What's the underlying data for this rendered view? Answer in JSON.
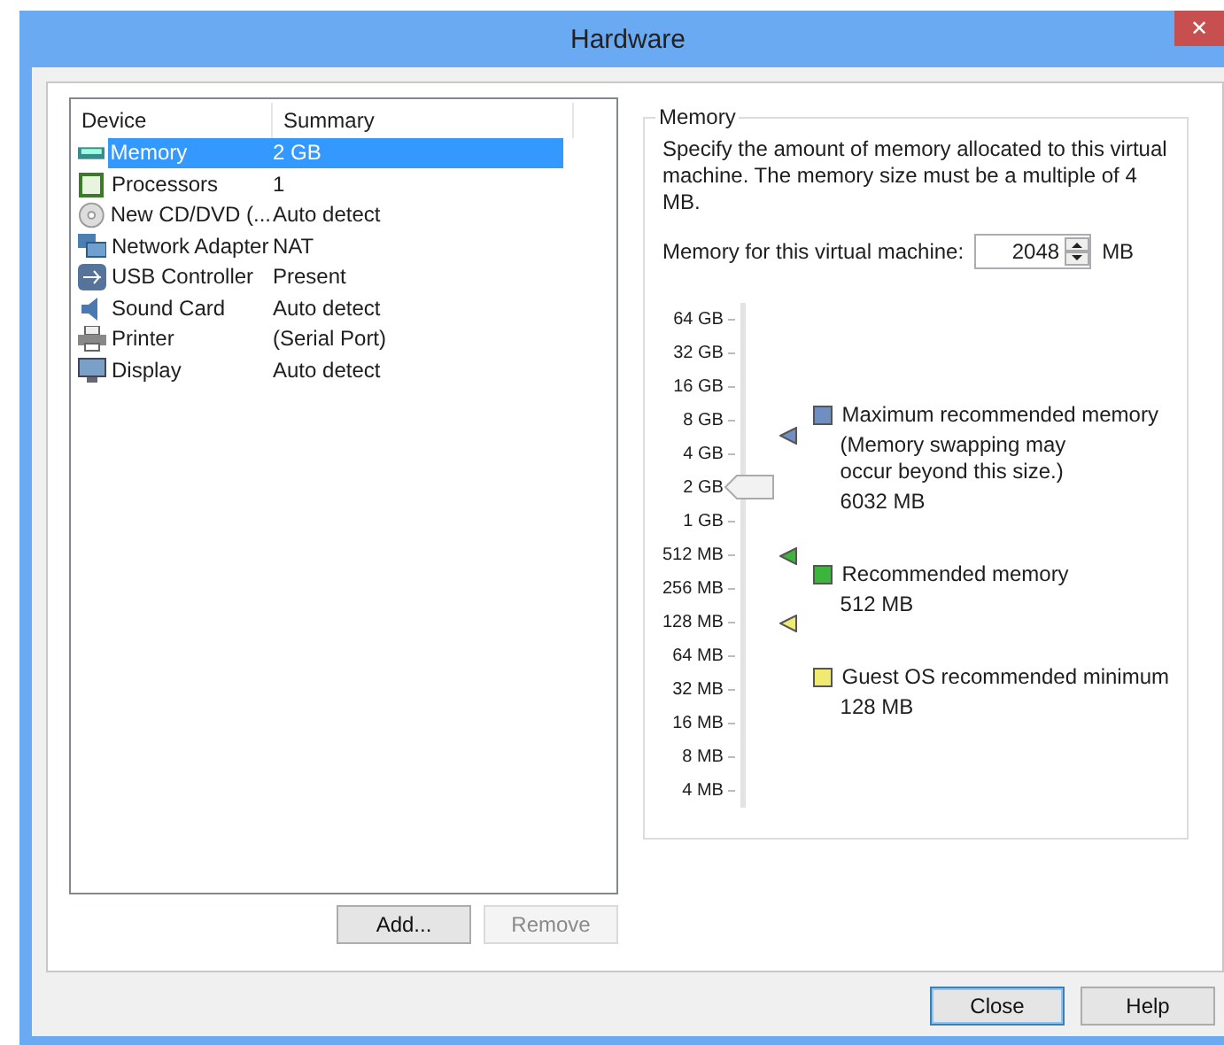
{
  "window": {
    "title": "Hardware",
    "close": "✕"
  },
  "devices": {
    "columns": [
      "Device",
      "Summary"
    ],
    "rows": [
      {
        "kind": "memory",
        "name": "Memory",
        "summary": "2 GB",
        "selected": true
      },
      {
        "kind": "cpu",
        "name": "Processors",
        "summary": "1",
        "selected": false
      },
      {
        "kind": "disc",
        "name": "New CD/DVD (...",
        "summary": "Auto detect",
        "selected": false
      },
      {
        "kind": "network",
        "name": "Network Adapter",
        "summary": "NAT",
        "selected": false
      },
      {
        "kind": "usb",
        "name": "USB Controller",
        "summary": "Present",
        "selected": false
      },
      {
        "kind": "sound",
        "name": "Sound Card",
        "summary": "Auto detect",
        "selected": false
      },
      {
        "kind": "printer",
        "name": "Printer",
        "summary": "(Serial Port)",
        "selected": false
      },
      {
        "kind": "display",
        "name": "Display",
        "summary": "Auto detect",
        "selected": false
      }
    ],
    "buttons": [
      {
        "label": "Add...",
        "disabled": false
      },
      {
        "label": "Remove",
        "disabled": true
      }
    ]
  },
  "memory": {
    "title": "Memory",
    "description": "Specify the amount of memory allocated to this virtual machine. The memory size must be a multiple of 4 MB.",
    "field_label": "Memory for this virtual machine:",
    "value": "2048",
    "unit": "MB",
    "scale": [
      "64 GB",
      "32 GB",
      "16 GB",
      "8 GB",
      "4 GB",
      "2 GB",
      "1 GB",
      "512 MB",
      "256 MB",
      "128 MB",
      "64 MB",
      "32 MB",
      "16 MB",
      "8 MB",
      "4 MB"
    ],
    "slider": {
      "level": 0.643
    },
    "legend": [
      {
        "label": "Maximum recommended memory",
        "note": "(Memory swapping may occur beyond this size.)",
        "value": "6032 MB",
        "color": "#6f8fc0",
        "level": 0.754
      },
      {
        "label": "Recommended memory",
        "value": "512 MB",
        "color": "#3bb53b",
        "level": 0.5
      },
      {
        "label": "Guest OS recommended minimum",
        "value": "128 MB",
        "color": "#f0eb70",
        "level": 0.357
      }
    ]
  },
  "footer": {
    "buttons": [
      {
        "label": "Close",
        "default": true
      },
      {
        "label": "Help",
        "default": false
      }
    ]
  }
}
